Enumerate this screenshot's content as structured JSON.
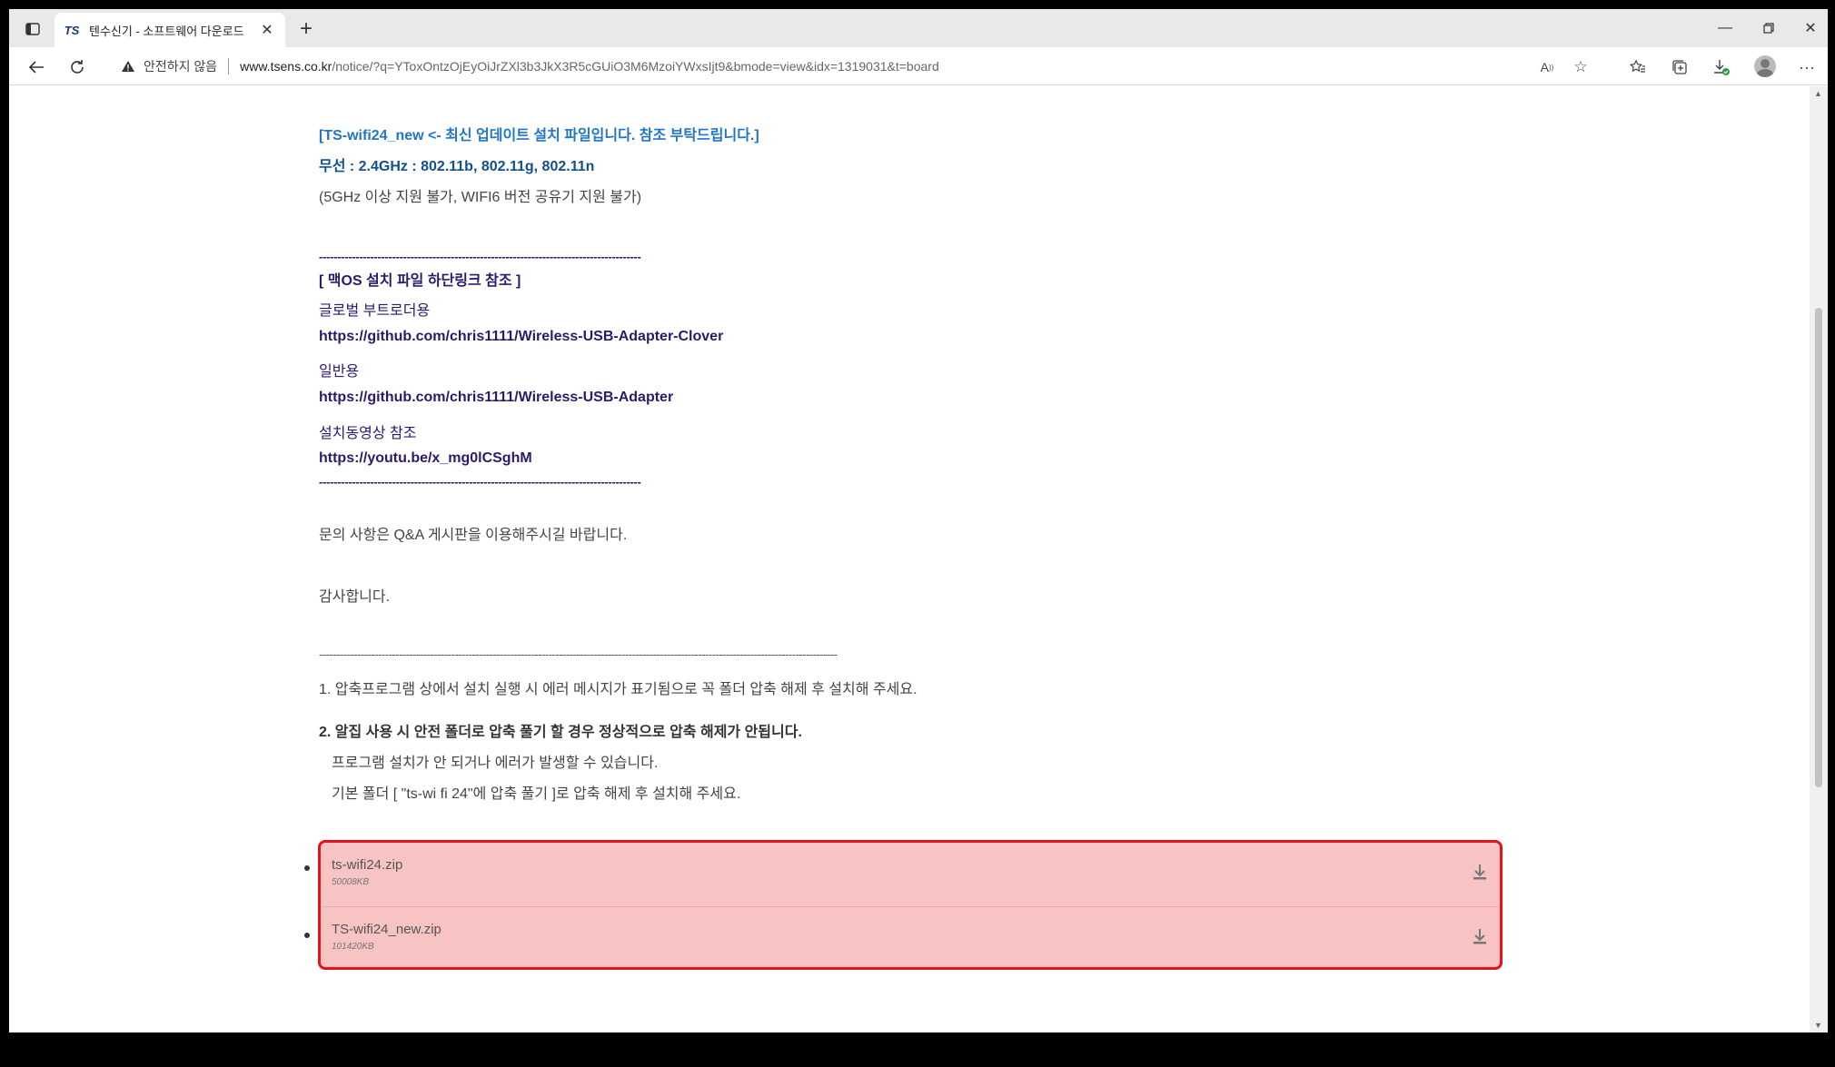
{
  "browser": {
    "tab_title": "텐수신기 - 소프트웨어 다운로드",
    "tab_favicon": "TS",
    "security_label": "안전하지 않음",
    "url_host": "www.tsens.co.kr",
    "url_path": "/notice/?q=YToxOntzOjEyOiJrZXl3b3JkX3R5cGUiO3M6MzoiYWxsIjt9&bmode=view&idx=1319031&t=board",
    "icons": {
      "sidebar": "sidebar-icon",
      "close": "close-icon",
      "new_tab": "plus-icon",
      "back": "back-arrow-icon",
      "reload": "reload-icon",
      "warning": "warning-icon",
      "read_aloud": "read-aloud-icon",
      "add_favorite": "star-plus-icon",
      "favorites": "favorites-icon",
      "collections": "collections-icon",
      "downloads": "download-icon",
      "profile": "avatar-icon",
      "more": "more-icon"
    }
  },
  "article": {
    "line1": "[TS-wifi24_new <- 최신 업데이트 설치 파일입니다. 참조 부탁드립니다.]",
    "line2": "무선 : 2.4GHz : 802.11b, 802.11g, 802.11n",
    "line3": "(5GHz 이상 지원 불가, WIFI6 버전 공유기 지원 불가)",
    "dashes_short": "----------------------------------------------------------------------------------------",
    "mac_header": "[ 맥OS 설치 파일 하단링크 참조  ]",
    "global_label": "글로벌 부트로더용",
    "link_clover": "https://github.com/chris1111/Wireless-USB-Adapter-Clover",
    "general_label": "일반용",
    "link_general": "https://github.com/chris1111/Wireless-USB-Adapter",
    "video_label": "설치동영상 참조",
    "link_video": "https://youtu.be/x_mg0lCSghM",
    "inquiry": "문의 사항은 Q&A 게시판을 이용해주시길 바랍니다.",
    "thanks": "감사합니다.",
    "dashes_long": "-----------------------------------------------------------------------------------------------------------------------------------------------------",
    "note1": "1. 압축프로그램 상에서 설치 실행 시 에러 메시지가 표기됨으로 꼭 폴더 압축 해제 후 설치해 주세요.",
    "note2": "2. 알집 사용 시 안전 폴더로 압축 풀기 할 경우 정상적으로 압축 해제가 안됩니다.",
    "note2a": "프로그램 설치가 안 되거나 에러가 발생할 수 있습니다.",
    "note2b": "기본 폴더 [ \"ts-wi fi 24\"에 압축 풀기 ]로 압축 해제 후 설치해 주세요."
  },
  "attachments": [
    {
      "name": "ts-wifi24.zip",
      "size": "50008KB"
    },
    {
      "name": "TS-wifi24_new.zip",
      "size": "101420KB"
    }
  ],
  "colors": {
    "highlight_border": "#e0141e",
    "highlight_fill": "#f7c3c3",
    "link_blue": "#1f76c9",
    "link_purple": "#2a1a6e"
  }
}
